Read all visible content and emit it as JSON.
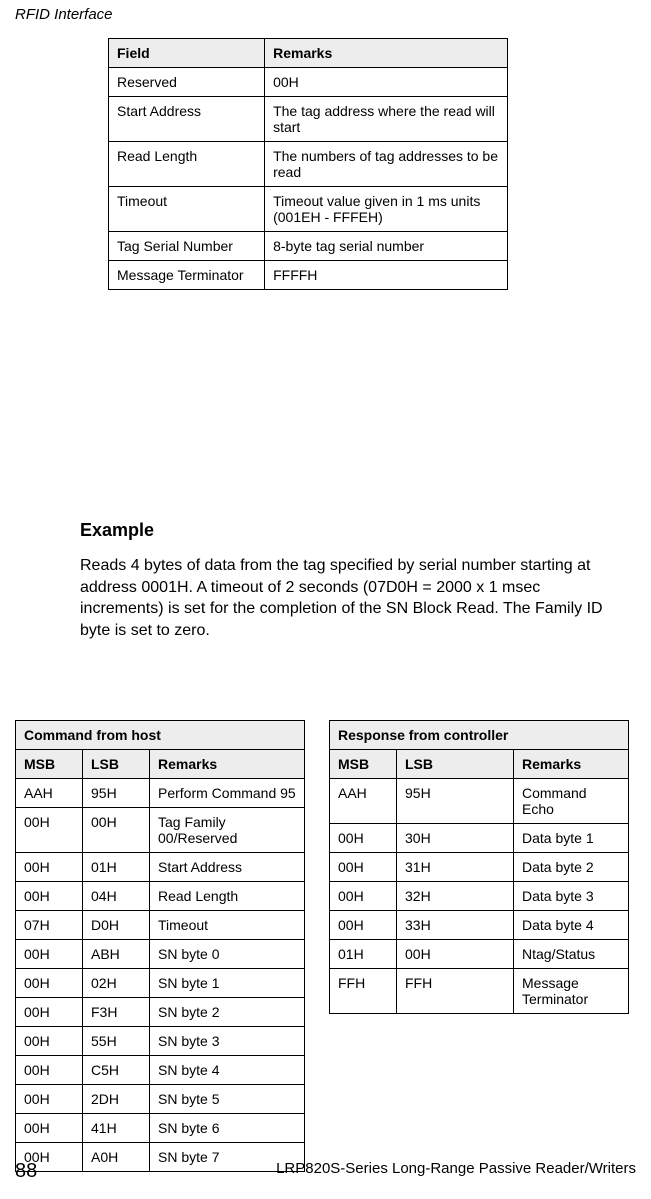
{
  "header": {
    "title": "RFID Interface"
  },
  "table1": {
    "headers": [
      "Field",
      "Remarks"
    ],
    "rows": [
      [
        "Reserved",
        "00H"
      ],
      [
        "Start Address",
        "The tag address where the read will start"
      ],
      [
        "Read Length",
        "The numbers of tag addresses to be read"
      ],
      [
        "Timeout",
        "Timeout value given in 1 ms units (001EH - FFFEH)"
      ],
      [
        "Tag Serial Number",
        "8-byte tag serial number"
      ],
      [
        "Message Terminator",
        "FFFFH"
      ]
    ]
  },
  "example": {
    "heading": "Example",
    "body": "Reads 4 bytes of data from the tag specified by serial number starting at address 0001H. A timeout of 2 seconds (07D0H = 2000 x 1 msec increments) is set for the completion of the SN Block Read. The Family ID byte is set to zero."
  },
  "table2": {
    "title": "Command from host",
    "headers": [
      "MSB",
      "LSB",
      "Remarks"
    ],
    "rows": [
      [
        "AAH",
        "95H",
        "Perform Command 95"
      ],
      [
        "00H",
        "00H",
        "Tag Family 00/Reserved"
      ],
      [
        "00H",
        "01H",
        "Start Address"
      ],
      [
        "00H",
        "04H",
        "Read Length"
      ],
      [
        "07H",
        "D0H",
        "Timeout"
      ],
      [
        "00H",
        "ABH",
        "SN byte 0"
      ],
      [
        "00H",
        "02H",
        "SN byte 1"
      ],
      [
        "00H",
        "F3H",
        "SN byte 2"
      ],
      [
        "00H",
        "55H",
        "SN byte 3"
      ],
      [
        "00H",
        "C5H",
        "SN byte 4"
      ],
      [
        "00H",
        "2DH",
        "SN byte 5"
      ],
      [
        "00H",
        "41H",
        "SN byte 6"
      ],
      [
        "00H",
        "A0H",
        "SN byte 7"
      ]
    ]
  },
  "table3": {
    "title": "Response from controller",
    "headers": [
      "MSB",
      "LSB",
      "Remarks"
    ],
    "rows": [
      [
        "AAH",
        "95H",
        "Command Echo"
      ],
      [
        "00H",
        "30H",
        "Data byte 1"
      ],
      [
        "00H",
        "31H",
        "Data byte 2"
      ],
      [
        "00H",
        "32H",
        "Data byte 3"
      ],
      [
        "00H",
        "33H",
        "Data byte 4"
      ],
      [
        "01H",
        "00H",
        "Ntag/Status"
      ],
      [
        "FFH",
        "FFH",
        "Message Terminator"
      ]
    ]
  },
  "footer": {
    "page": "88",
    "doc": "LRP820S-Series Long-Range Passive Reader/Writers"
  }
}
